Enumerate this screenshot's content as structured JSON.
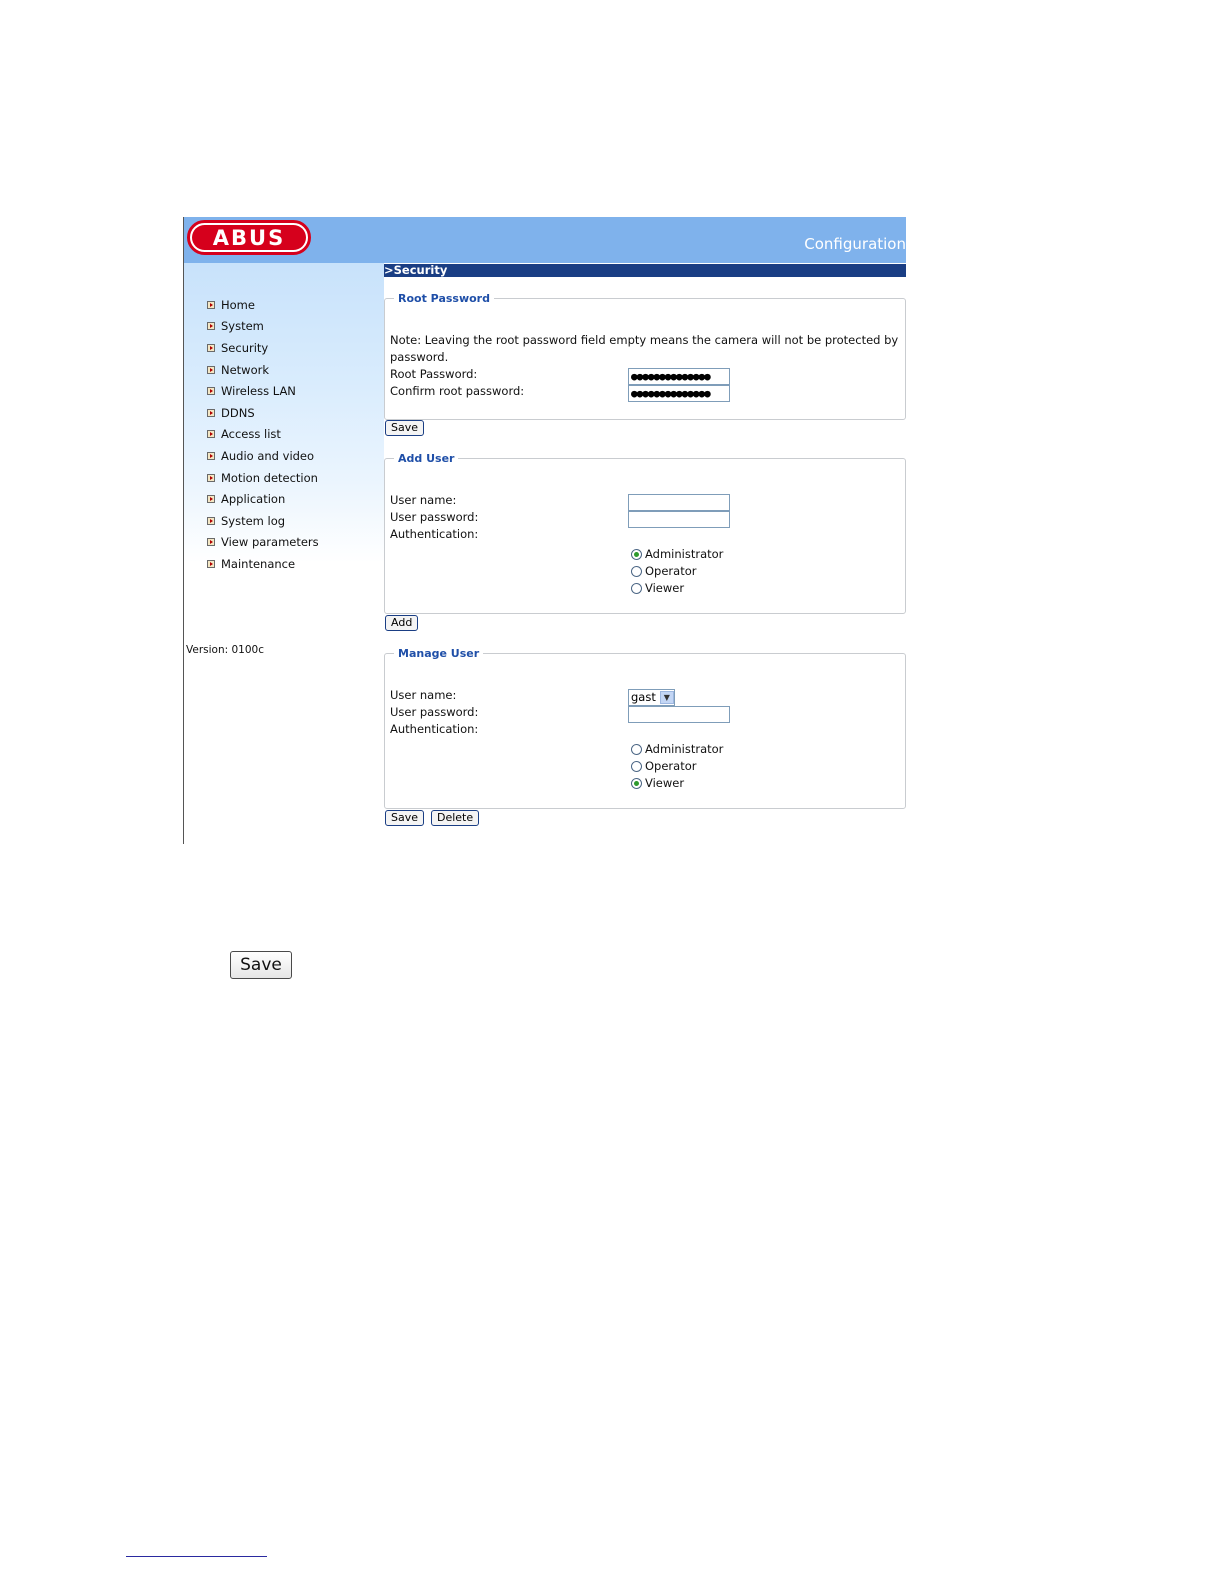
{
  "header": {
    "logo_text": "ABUS",
    "title": "Configuration"
  },
  "sidebar": {
    "items": [
      {
        "label": "Home"
      },
      {
        "label": "System"
      },
      {
        "label": "Security"
      },
      {
        "label": "Network"
      },
      {
        "label": "Wireless LAN"
      },
      {
        "label": "DDNS"
      },
      {
        "label": "Access list"
      },
      {
        "label": "Audio and video"
      },
      {
        "label": "Motion detection"
      },
      {
        "label": "Application"
      },
      {
        "label": "System log"
      },
      {
        "label": "View parameters"
      },
      {
        "label": "Maintenance"
      }
    ],
    "version": "Version: 0100c"
  },
  "section_title": ">Security",
  "root_password": {
    "legend": "Root Password",
    "note_line1": "Note: Leaving the root password field empty means the camera will not be protected by",
    "note_line2": "password.",
    "root_label": "Root Password:",
    "root_value": "●●●●●●●●●●●●●●",
    "confirm_label": "Confirm root password:",
    "confirm_value": "●●●●●●●●●●●●●●",
    "save_label": "Save"
  },
  "add_user": {
    "legend": "Add User",
    "username_label": "User name:",
    "username_value": "",
    "password_label": "User password:",
    "password_value": "",
    "auth_label": "Authentication:",
    "options": [
      {
        "label": "Administrator",
        "selected": true
      },
      {
        "label": "Operator",
        "selected": false
      },
      {
        "label": "Viewer",
        "selected": false
      }
    ],
    "add_label": "Add"
  },
  "manage_user": {
    "legend": "Manage User",
    "username_label": "User name:",
    "username_selected": "gast",
    "password_label": "User password:",
    "password_value": "",
    "auth_label": "Authentication:",
    "options": [
      {
        "label": "Administrator",
        "selected": false
      },
      {
        "label": "Operator",
        "selected": false
      },
      {
        "label": "Viewer",
        "selected": true
      }
    ],
    "save_label": "Save",
    "delete_label": "Delete"
  },
  "standalone_save_label": "Save",
  "colors": {
    "header_bg": "#7fb2ec",
    "section_bar": "#1a3e84",
    "legend_text": "#1f4fa8",
    "logo_red": "#d6001c",
    "radio_selected": "#2e9a2e"
  }
}
